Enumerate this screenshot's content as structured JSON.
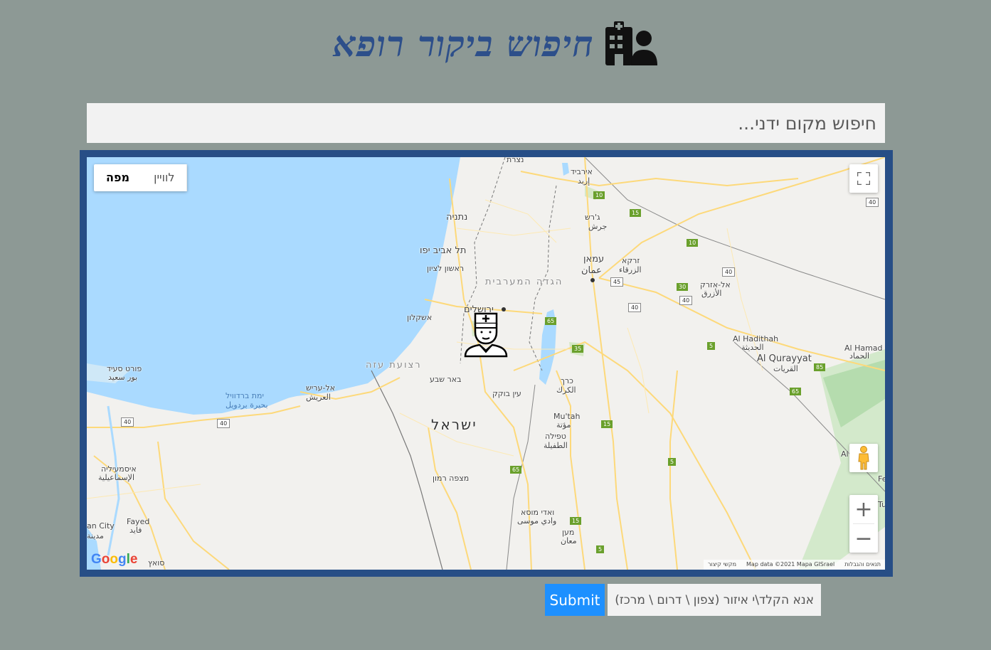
{
  "header": {
    "title": "חיפוש ביקור רופא",
    "icon": "hospital-user-icon"
  },
  "search": {
    "placeholder": "חיפוש מקום ידני..."
  },
  "map": {
    "map_type": {
      "map": "מפה",
      "satellite": "לוויין"
    },
    "controls": {
      "fullscreen_icon": "fullscreen-icon",
      "pegman_icon": "street-view-pegman-icon",
      "zoom_in": "+",
      "zoom_out": "−"
    },
    "attribution": {
      "logo": "Google",
      "shortcuts": "מקשי קיצור",
      "data": "Map data ©2021 Mapa GISrael",
      "terms": "תנאים והגבלות"
    },
    "marker_icon": "doctor-icon",
    "labels": {
      "nazareth": "נצרת",
      "irbid": "אירביד",
      "irbid_ar": "إربد",
      "netanya": "נתניה",
      "jerash": "ג'רש",
      "jerash_ar": "جرش",
      "tel_aviv": "תל אביב יפו",
      "rishon": "ראשון לציון",
      "amman": "עמאן",
      "amman_ar": "عمان",
      "zarqa": "זרקא",
      "zarqa_ar": "الزرقاء",
      "west_bank": "הגדה המערבית",
      "azraq": "אל-אזרק",
      "azraq_ar": "الأزرق",
      "jerusalem": "ירושלים",
      "ashkelon": "אשקלון",
      "haditha": "Al Hadithah",
      "haditha_ar": "الحديثة",
      "qurayyat": "Al Qurayyat",
      "qurayyat_ar": "القريات",
      "hamad": "Al Hamad",
      "hamad_ar": "الحماد",
      "port_said": "פורט סעיד",
      "port_said_ar": "بور سعيد",
      "gaza": "רצועת עזה",
      "beer_sheva": "באר שבע",
      "karak": "כרך",
      "karak_ar": "الكرك",
      "arish": "אל-עריש",
      "arish_ar": "العريش",
      "bardawil": "ימת ברדוויל",
      "bardawil_ar": "بحيرة بردويل",
      "ein_bokek": "עין בוקק",
      "israel": "ישראל",
      "mutah": "Mu'tah",
      "mutah_ar": "مؤتة",
      "tafilah": "טפילה",
      "tafilah_ar": "الطفيلة",
      "ismailia": "איסמעיליה",
      "ismailia_ar": "الإسماعيلية",
      "mitzpe": "מצפה רמון",
      "fayed": "Fayed",
      "fayed_ar": "فايد",
      "wadi_musa": "ואדי מוסא",
      "wadi_musa_ar": "وادي موسى",
      "maan": "מען",
      "maan_ar": "معان",
      "city": "an City",
      "city_ar": "مدينة",
      "suez": "סואץ",
      "edge_al": "Al",
      "edge_fe": "Fe",
      "edge_tu": "Tu"
    },
    "shields": [
      "10",
      "15",
      "10",
      "40",
      "40",
      "30",
      "45",
      "40",
      "40",
      "65",
      "35",
      "5",
      "85",
      "65",
      "40",
      "40",
      "15",
      "65",
      "5",
      "15",
      "5"
    ]
  },
  "form": {
    "submit_label": "Submit",
    "region_placeholder": "אנא הקלד\\י איזור (צפון \\ דרום \\ מרכז)"
  }
}
